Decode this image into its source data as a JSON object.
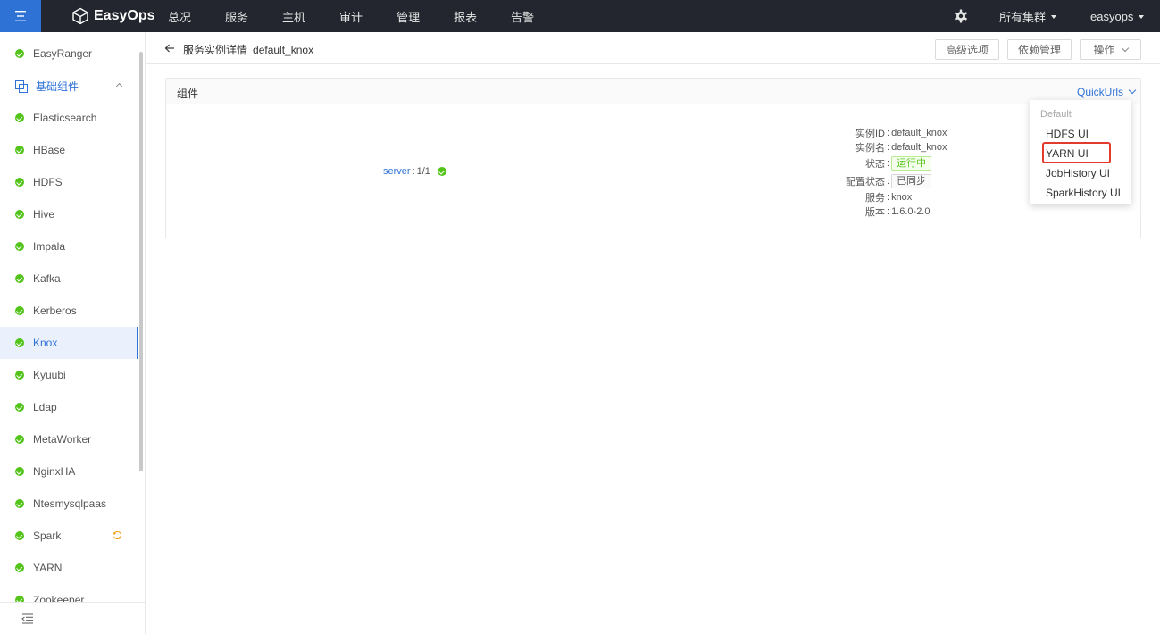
{
  "topbar": {
    "logo": "EasyOps",
    "nav": [
      "总况",
      "服务",
      "主机",
      "审计",
      "管理",
      "报表",
      "告警"
    ],
    "cluster": "所有集群",
    "user": "easyops"
  },
  "sidebar": {
    "items": [
      {
        "label": "EasyRanger",
        "type": "service"
      },
      {
        "label": "基础组件",
        "type": "group"
      },
      {
        "label": "Elasticsearch",
        "type": "service"
      },
      {
        "label": "HBase",
        "type": "service"
      },
      {
        "label": "HDFS",
        "type": "service"
      },
      {
        "label": "Hive",
        "type": "service"
      },
      {
        "label": "Impala",
        "type": "service"
      },
      {
        "label": "Kafka",
        "type": "service"
      },
      {
        "label": "Kerberos",
        "type": "service"
      },
      {
        "label": "Knox",
        "type": "service",
        "active": true
      },
      {
        "label": "Kyuubi",
        "type": "service"
      },
      {
        "label": "Ldap",
        "type": "service"
      },
      {
        "label": "MetaWorker",
        "type": "service"
      },
      {
        "label": "NginxHA",
        "type": "service"
      },
      {
        "label": "Ntesmysqlpaas",
        "type": "service"
      },
      {
        "label": "Spark",
        "type": "service",
        "syncing": true
      },
      {
        "label": "YARN",
        "type": "service"
      },
      {
        "label": "Zookeeper",
        "type": "service"
      }
    ]
  },
  "header": {
    "breadcrumb": "服务实例详情",
    "instance": "default_knox",
    "buttons": {
      "advanced": "高级选项",
      "deps": "依赖管理",
      "ops": "操作"
    }
  },
  "card": {
    "title": "组件",
    "quickurls": "QuickUrls",
    "server": {
      "name": "server",
      "count": "1/1"
    },
    "info": [
      {
        "label": "实例ID",
        "value": "default_knox"
      },
      {
        "label": "实例名",
        "value": "default_knox"
      },
      {
        "label": "状态",
        "value": "运行中"
      },
      {
        "label": "配置状态",
        "value": "已同步"
      },
      {
        "label": "服务",
        "value": "knox"
      },
      {
        "label": "版本",
        "value": "1.6.0-2.0"
      }
    ]
  },
  "dropdown": {
    "header": "Default",
    "items": [
      "HDFS UI",
      "YARN UI",
      "JobHistory UI",
      "SparkHistory UI"
    ]
  },
  "colors": {
    "accent": "#2f72d6",
    "topbar": "#23262e",
    "success": "#52c41a",
    "highlight": "#e23b2e"
  },
  "icons": [
    "menu-icon",
    "cube-logo-icon",
    "gear-icon",
    "back-arrow-icon",
    "check-circle-icon",
    "sync-icon",
    "collapse-sidebar-icon"
  ]
}
